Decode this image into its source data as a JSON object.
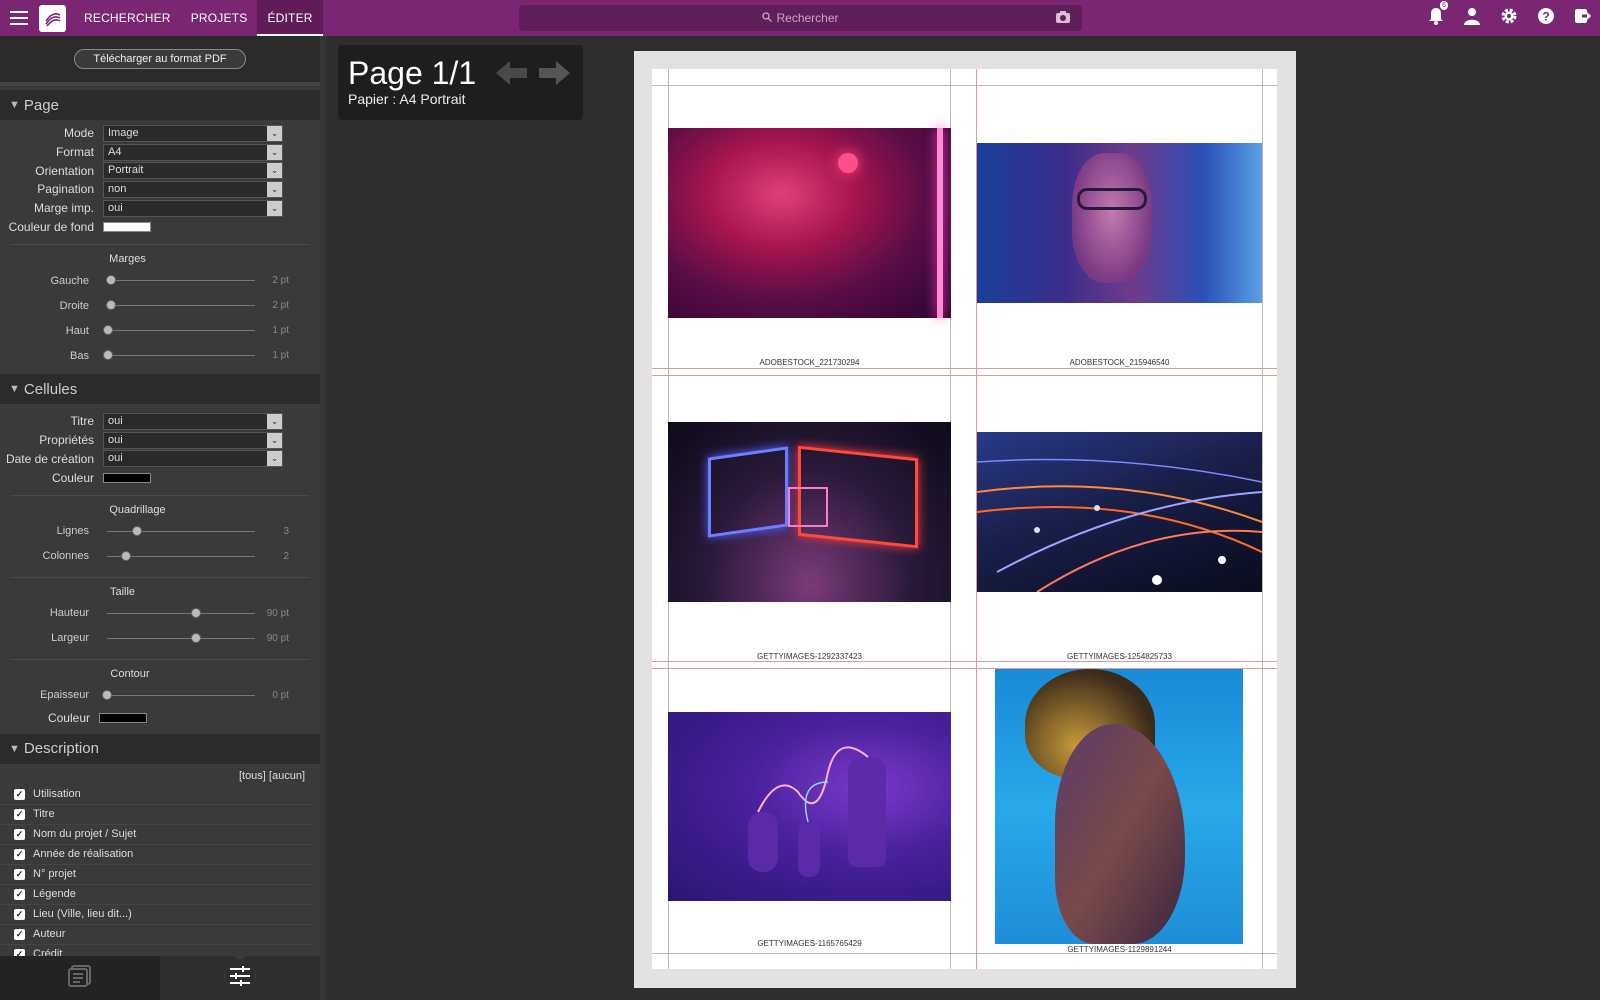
{
  "topbar": {
    "nav": [
      "RECHERCHER",
      "PROJETS",
      "ÉDITER"
    ],
    "active_index": 2,
    "search_placeholder": "Rechercher",
    "notification_count": "6"
  },
  "sidebar": {
    "pdf_button": "Télécharger au format PDF",
    "page_section": {
      "title": "Page",
      "fields": [
        {
          "label": "Mode",
          "value": "Image"
        },
        {
          "label": "Format",
          "value": "A4"
        },
        {
          "label": "Orientation",
          "value": "Portrait"
        },
        {
          "label": "Pagination",
          "value": "non"
        },
        {
          "label": "Marge imp.",
          "value": "oui"
        }
      ],
      "bg_color_label": "Couleur de fond",
      "bg_color": "#ffffff",
      "margins_title": "Marges",
      "margins": [
        {
          "label": "Gauche",
          "value": "2 pt",
          "level": 0.03
        },
        {
          "label": "Droite",
          "value": "2 pt",
          "level": 0.03
        },
        {
          "label": "Haut",
          "value": "1 pt",
          "level": 0.01
        },
        {
          "label": "Bas",
          "value": "1 pt",
          "level": 0.01
        }
      ]
    },
    "cells_section": {
      "title": "Cellules",
      "fields": [
        {
          "label": "Titre",
          "value": "oui"
        },
        {
          "label": "Propriétés",
          "value": "oui"
        },
        {
          "label": "Date de création",
          "value": "oui"
        }
      ],
      "color_label": "Couleur",
      "color": "#000000",
      "grid_title": "Quadrillage",
      "grid": [
        {
          "label": "Lignes",
          "value": "3",
          "level": 0.2
        },
        {
          "label": "Colonnes",
          "value": "2",
          "level": 0.13
        }
      ],
      "size_title": "Taille",
      "size": [
        {
          "label": "Hauteur",
          "value": "90 pt",
          "level": 0.6
        },
        {
          "label": "Largeur",
          "value": "90 pt",
          "level": 0.6
        }
      ],
      "border_title": "Contour",
      "border_thickness": {
        "label": "Epaisseur",
        "value": "0 pt",
        "level": 0.0
      },
      "border_color_label": "Couleur",
      "border_color": "#000000"
    },
    "description_section": {
      "title": "Description",
      "toggles": "[tous] [aucun]",
      "items": [
        "Utilisation",
        "Titre",
        "Nom du projet / Sujet",
        "Année de réalisation",
        "N° projet",
        "Légende",
        "Lieu (Ville, lieu dit...)",
        "Auteur",
        "Crédit"
      ]
    }
  },
  "page_info": {
    "title": "Page 1/1",
    "paper": "Papier : A4 Portrait"
  },
  "sheet": {
    "captions": [
      "ADOBESTOCK_221730294",
      "ADOBESTOCK_215946540",
      "GETTYIMAGES-1292337423",
      "GETTYIMAGES-1254825733",
      "GETTYIMAGES-1165765429",
      "GETTYIMAGES-1129891244"
    ],
    "images": [
      "neon-woman-photo",
      "woman-glasses-photo",
      "neon-frames-photo",
      "light-streaks-photo",
      "neon-vases-photo",
      "portrait-profile-photo"
    ]
  }
}
